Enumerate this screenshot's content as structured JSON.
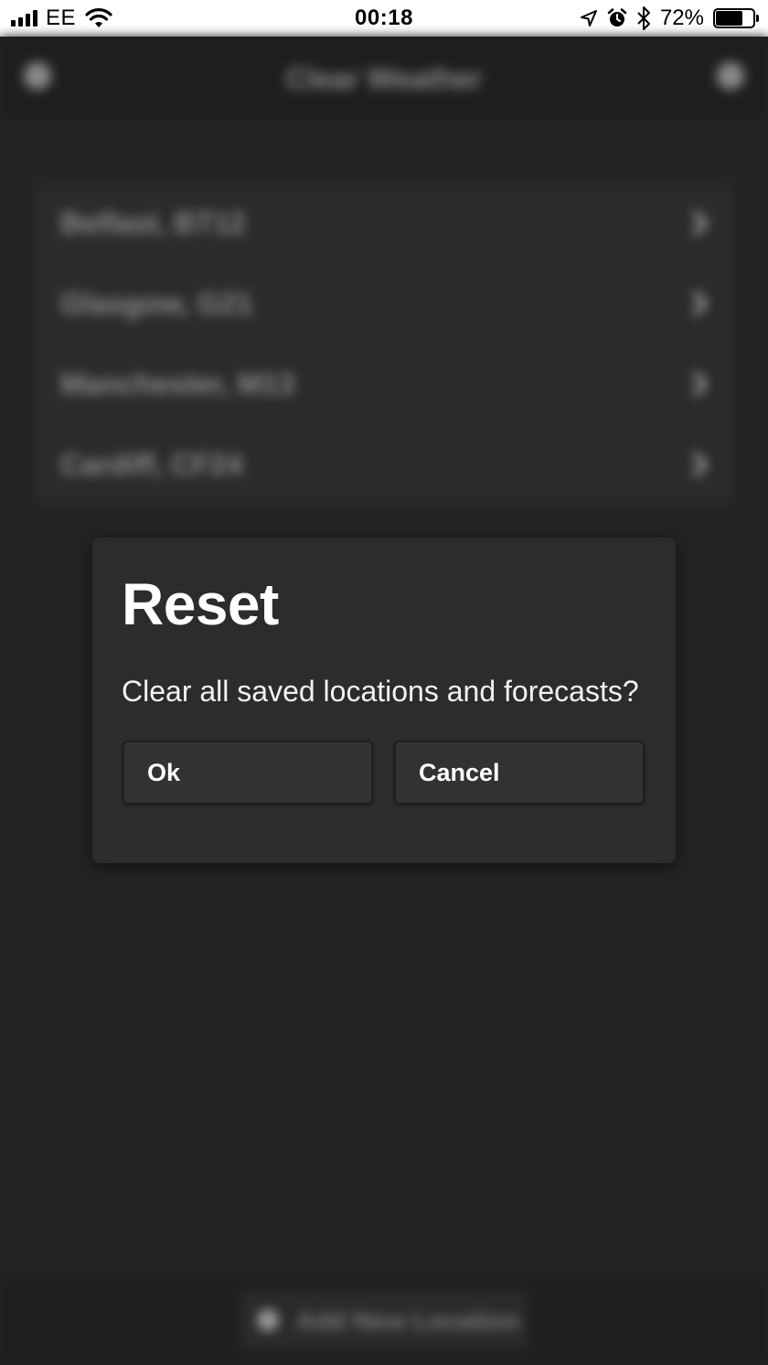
{
  "status_bar": {
    "carrier": "EE",
    "time": "00:18",
    "battery_percent": "72%",
    "battery_level": 0.72,
    "icons": [
      "signal-icon",
      "wifi-icon",
      "location-arrow-icon",
      "alarm-icon",
      "bluetooth-icon",
      "battery-icon"
    ]
  },
  "app": {
    "title": "Clear Weather",
    "locations": [
      {
        "label": "Belfast, BT12"
      },
      {
        "label": "Glasgow, G21"
      },
      {
        "label": "Manchester, M13"
      },
      {
        "label": "Cardiff, CF24"
      }
    ],
    "add_location_label": "Add New Location"
  },
  "dialog": {
    "title": "Reset",
    "message": "Clear all saved locations and forecasts?",
    "ok_label": "Ok",
    "cancel_label": "Cancel"
  },
  "colors": {
    "background": "#242424",
    "dialog_background": "#2c2c2c",
    "button_background": "#323232",
    "text": "#ffffff"
  }
}
